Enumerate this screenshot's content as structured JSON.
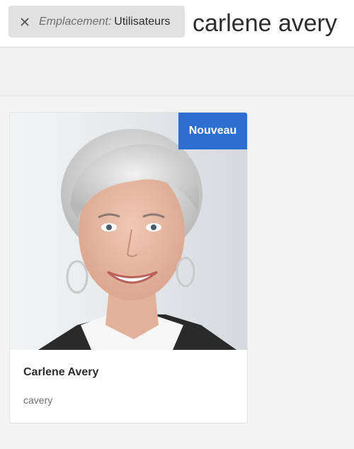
{
  "search": {
    "filter_tag": {
      "key": "Emplacement:",
      "value": "Utilisateurs",
      "close_icon": "close-icon"
    },
    "query": "carlene avery"
  },
  "results": [
    {
      "badge": "Nouveau",
      "title": "Carlene Avery",
      "subtitle": "cavery",
      "thumbnail": "user-portrait-photo"
    }
  ],
  "colors": {
    "badge_bg": "#2d6fd0",
    "tag_bg": "#e1e1e1",
    "page_bg": "#f4f4f4"
  }
}
